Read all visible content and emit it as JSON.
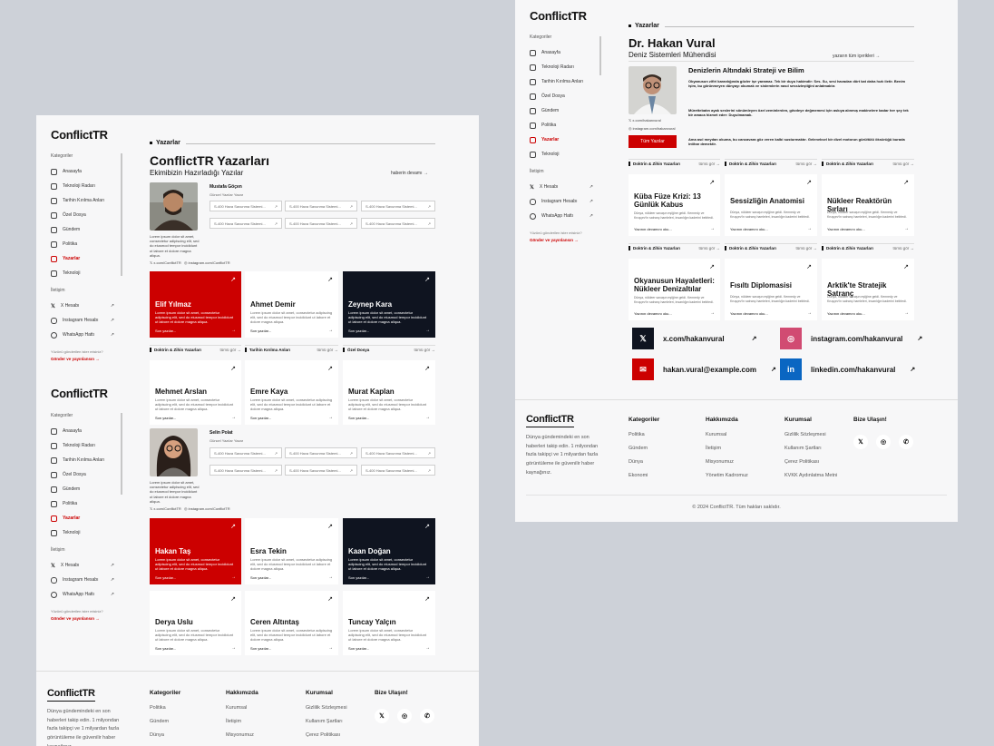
{
  "brand": "ConflictTR",
  "sidebar": {
    "cat_label": "Kategoriler",
    "items": [
      "Anasayfa",
      "Teknoloji Radarı",
      "Tarihin Kırılma Anları",
      "Özel Dosya",
      "Gündem",
      "Politika",
      "Yazarlar",
      "Teknoloji"
    ],
    "comm_label": "İletişim",
    "comm": [
      "X Hesabı",
      "Instagram Hesabı",
      "WhatsApp Hattı"
    ],
    "note": "Yüzünü gönderilen ister misiniz?",
    "send": "Gönder ve yayınlansın →"
  },
  "left": {
    "section": "Yazarlar",
    "title": "ConflictTR Yazarları",
    "subtitle": "Ekimibizin Hazırladığı Yazılar",
    "read_more": "haberin devamı",
    "featured1": {
      "name": "Mustafa Göçen",
      "role": "Güncel Yazılar Yazar",
      "x": "x.com/ConflictTR",
      "ig": "instagram.com/ConflictTR"
    },
    "featured2": {
      "name": "Selin Polat",
      "role": "Güncel Yazılar Yazar",
      "x": "x.com/ConflictTR",
      "ig": "instagram.com/ConflictTR"
    },
    "chip": "S-400 Hava Savunma Sistemi...",
    "bio": "Lorem ipsum dolor sit amet, consectetur adipiscing elit, sed do eiusmod tempor incididunt ut labore et dolore magna aliqua.",
    "tile_desc": "Lorem ipsum dolor sit amet, consectetur adipiscing elit, sed do eiusmod tempor incididunt ut labore et dolore magna aliqua.",
    "more": "Son yazılar...",
    "row1": [
      "Elif Yılmaz",
      "Ahmet Demir",
      "Zeynep Kara"
    ],
    "bars": [
      {
        "t": "Doktrin & Zihin Yazarları",
        "l": "tümü gör"
      },
      {
        "t": "Tarihin Kırılma Anları",
        "l": "tümü gör"
      },
      {
        "t": "Özel Dosya",
        "l": "tümü gör"
      }
    ],
    "row2": [
      "Mehmet Arslan",
      "Emre Kaya",
      "Murat Kaplan"
    ],
    "row3": [
      "Hakan Taş",
      "Esra Tekin",
      "Kaan Doğan"
    ],
    "row4": [
      "Derya Uslu",
      "Ceren Altıntaş",
      "Tuncay Yalçın"
    ]
  },
  "right": {
    "section": "Yazarlar",
    "name": "Dr. Hakan Vural",
    "role": "Deniz Sistemleri Mühendisi",
    "all_link": "yazarın tüm içerikleri",
    "article_title": "Denizlerin Altındaki Strateji ve Bilim",
    "p1": "Okyanusun zifiri karanlığında gözler işe yaramaz. Tek bir duyu hakimdir: Ses. Su, sesi havadan dört kat daha hızlı iletir. Benim işim, bu görünmeyen dünyayı okumak ve sistemlerin nasıl sessizleştiğini anlatmaktır.",
    "p2": "Mürettebatın ayak seslerini sönümleyen özel zeminlerden, gövdeye değmemesi için askıya alınmış makinelere kadar her şey tek bir amaca hizmet eder: Duyulmamak.",
    "p3": "Ama asıl meydan okuma, bu cancavara göz veren kalbi susturmaktır. Geleneksel bir dizel motorun gürültülü öksürüğü burada intihar demektir.",
    "x": "x.com/hakanvural",
    "ig": "instagram.com/hakanvural",
    "all_btn": "Tüm Yazılar",
    "bar_title": "Doktrin & Zihin Yazarları",
    "bar_link": "tümü gör",
    "articles": [
      {
        "t": "Küba Füze Krizi: 13 Günlük Kabus"
      },
      {
        "t": "Sessizliğin Anatomisi"
      },
      {
        "t": "Nükleer Reaktörün Sırları"
      },
      {
        "t": "Okyanusun Hayaletleri: Nükleer Denizaltılar"
      },
      {
        "t": "Fısıltı Diplomasisi"
      },
      {
        "t": "Arktik'te Stratejik Satranç"
      }
    ],
    "art_desc": "Dünya, nükleer savaşın eşiğine geldi. Kennedy ve Kruşçev'in satranç hamleleri, insanlığın kaderini belirledi.",
    "art_more": "Yazının devamını oku...",
    "contacts": {
      "x": "x.com/hakanvural",
      "ig": "instagram.com/hakanvural",
      "mail": "hakan.vural@example.com",
      "li": "linkedin.com/hakanvural"
    }
  },
  "footer": {
    "about": "Dünya gündemindeki en son haberleri takip edin. 1 milyondan fazla takipçi ve 1 milyardan fazla görüntüleme ile güvenilir haber kaynağınız.",
    "cols": [
      {
        "h": "Kategoriler",
        "items": [
          "Politika",
          "Gündem",
          "Dünya",
          "Ekonomi"
        ]
      },
      {
        "h": "Hakkımızda",
        "items": [
          "Kurumsal",
          "İletişim",
          "Misyonumuz",
          "Yönetim Kadromuz"
        ]
      },
      {
        "h": "Kurumsal",
        "items": [
          "Gizlilik Sözleşmesi",
          "Kullanım Şartları",
          "Çerez Politikası",
          "KVKK Aydınlatma Metni"
        ]
      }
    ],
    "contact_h": "Bize Ulaşın!",
    "copy": "© 2024 ConflictTR. Tüm hakları saklıdır."
  },
  "colors": {
    "accent": "#cc0000",
    "dark": "#0f1420"
  }
}
